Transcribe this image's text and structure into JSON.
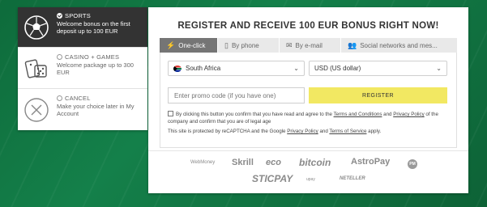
{
  "bonus_options": [
    {
      "title": "SPORTS",
      "description": "Welcome bonus on the first deposit up to 100 EUR",
      "selected": true,
      "icon": "soccer-ball-icon"
    },
    {
      "title": "CASINO + GAMES",
      "description": "Welcome package up to 300 EUR",
      "selected": false,
      "icon": "dice-cards-icon"
    },
    {
      "title": "CANCEL",
      "description": "Make your choice later in My Account",
      "selected": false,
      "icon": "cancel-x-icon"
    }
  ],
  "registration": {
    "title": "REGISTER AND RECEIVE 100 EUR BONUS RIGHT NOW!",
    "tabs": [
      {
        "label": "One-click",
        "icon": "lightning-icon",
        "active": true
      },
      {
        "label": "By phone",
        "icon": "phone-icon",
        "active": false
      },
      {
        "label": "By e-mail",
        "icon": "envelope-icon",
        "active": false
      },
      {
        "label": "Social networks and mes...",
        "icon": "people-icon",
        "active": false
      }
    ],
    "country": "South Africa",
    "currency": "USD (US dollar)",
    "promo_placeholder": "Enter promo code (if you have one)",
    "register_label": "REGISTER",
    "terms": {
      "part1": "By clicking this button you confirm that you have read and agree to the ",
      "link1": "Terms and Conditions",
      "part2": " and ",
      "link2": "Privacy Policy",
      "part3": " of the company and confirm that you are of legal age"
    },
    "recaptcha": {
      "part1": "This site is protected by reCAPTCHA and the Google ",
      "link1": "Privacy Policy",
      "part2": " and ",
      "link2": "Terms of Service",
      "part3": " apply."
    }
  },
  "payment_methods": [
    "WebMoney",
    "Skrill",
    "eco",
    "bitcoin",
    "AstroPay",
    "PM",
    "STICPAY",
    "upay",
    "NETELLER"
  ],
  "colors": {
    "background": "#0e6b3b",
    "active_option": "#333333",
    "active_tab": "#757575",
    "register_button": "#f2e862"
  }
}
